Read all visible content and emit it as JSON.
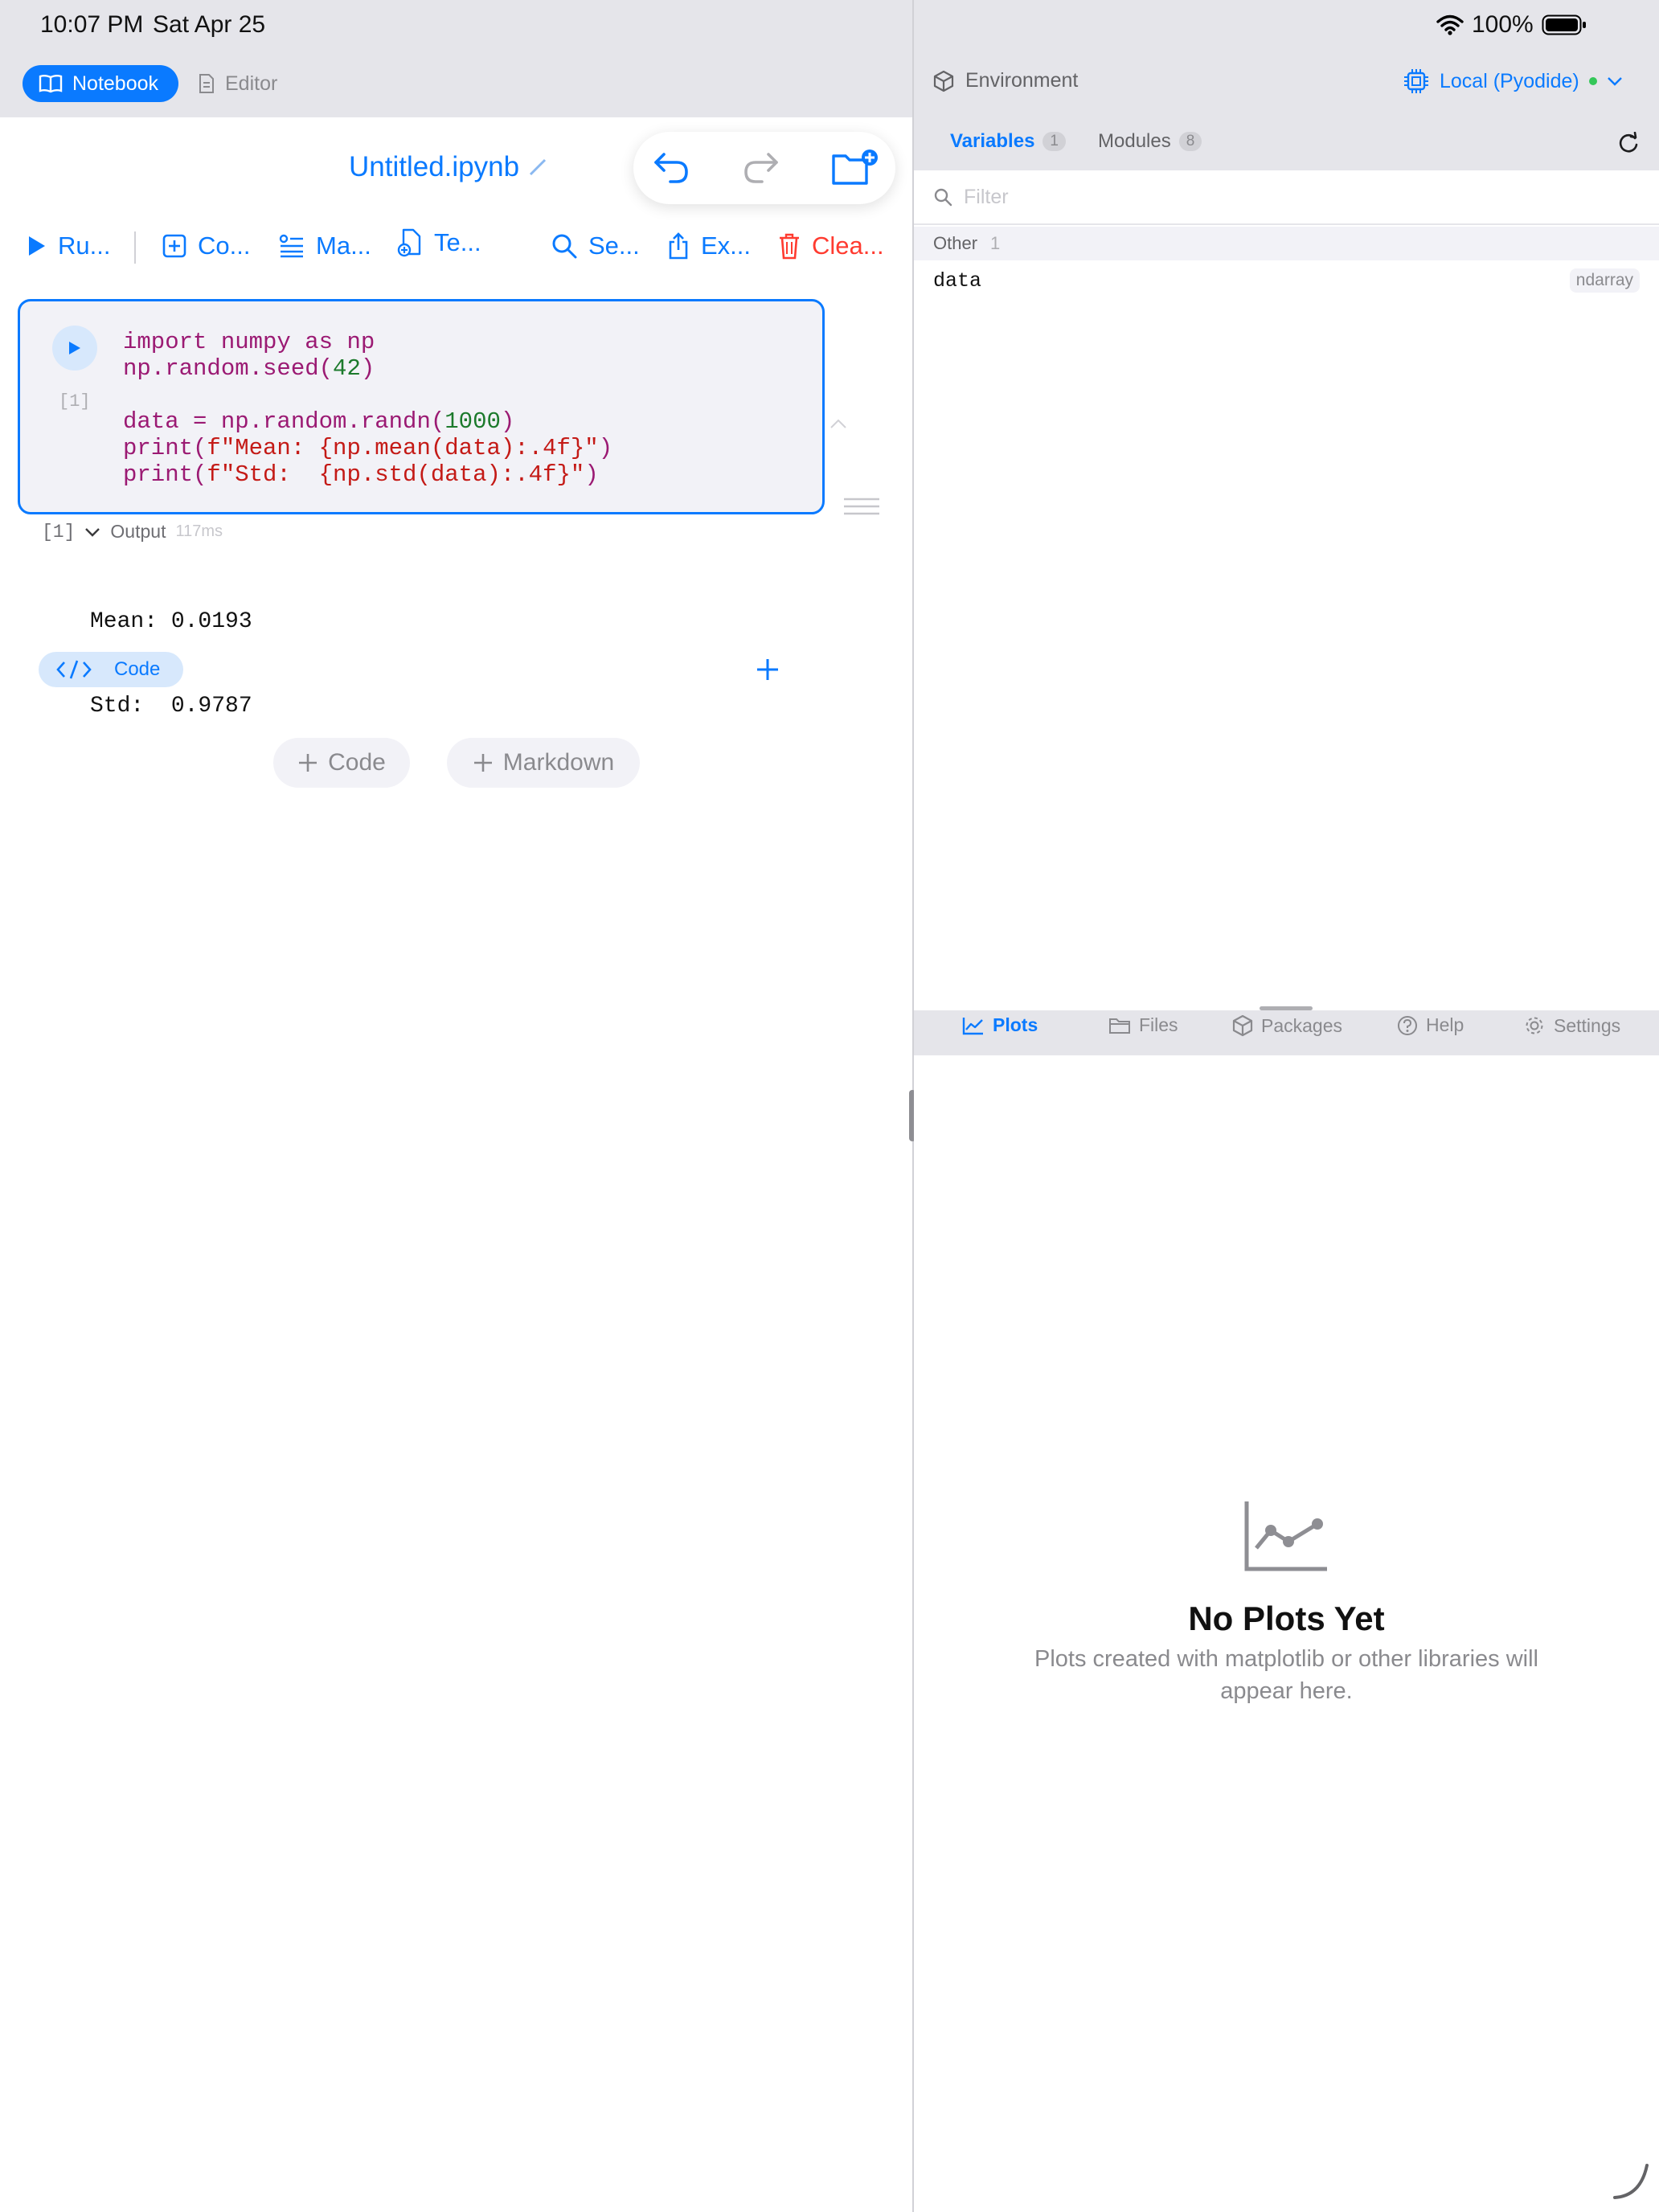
{
  "status": {
    "time": "10:07 PM",
    "date": "Sat Apr 25",
    "battery": "100%"
  },
  "mode_tabs": {
    "notebook": "Notebook",
    "editor": "Editor"
  },
  "notebook": {
    "title": "Untitled.ipynb"
  },
  "toolbar": {
    "run": "Ru...",
    "code": "Co...",
    "markdown": "Ma...",
    "template": "Te...",
    "search": "Se...",
    "export": "Ex...",
    "clear": "Clea..."
  },
  "cell": {
    "exec_count": "[1]",
    "code_lines": [
      "import numpy as np",
      "np.random.seed(42)",
      "",
      "data = np.random.randn(1000)",
      "print(f\"Mean: {np.mean(data):.4f}\")",
      "print(f\"Std:  {np.std(data):.4f}\")"
    ],
    "output_count": "[1]",
    "output_label": "Output",
    "output_time": "117ms",
    "output_lines": [
      "Mean: 0.0193",
      "Std:  0.9787"
    ],
    "type_chip": "Code"
  },
  "add_buttons": {
    "code": "Code",
    "markdown": "Markdown"
  },
  "environment": {
    "title": "Environment",
    "kernel": "Local (Pyodide)",
    "kernel_status_color": "#34c759",
    "tabs": [
      {
        "label": "Variables",
        "count": "1"
      },
      {
        "label": "Modules",
        "count": "8"
      }
    ],
    "filter_placeholder": "Filter",
    "group": {
      "label": "Other",
      "count": "1"
    },
    "variables": [
      {
        "name": "data",
        "type": "ndarray"
      }
    ]
  },
  "bottom_tabs": [
    "Plots",
    "Files",
    "Packages",
    "Help",
    "Settings"
  ],
  "plots_empty": {
    "title": "No Plots Yet",
    "line1": "Plots created with matplotlib or other libraries will",
    "line2": "appear here."
  },
  "colors": {
    "accent": "#0a7aff",
    "destructive": "#ff3b30",
    "chrome": "#e5e5ea"
  }
}
